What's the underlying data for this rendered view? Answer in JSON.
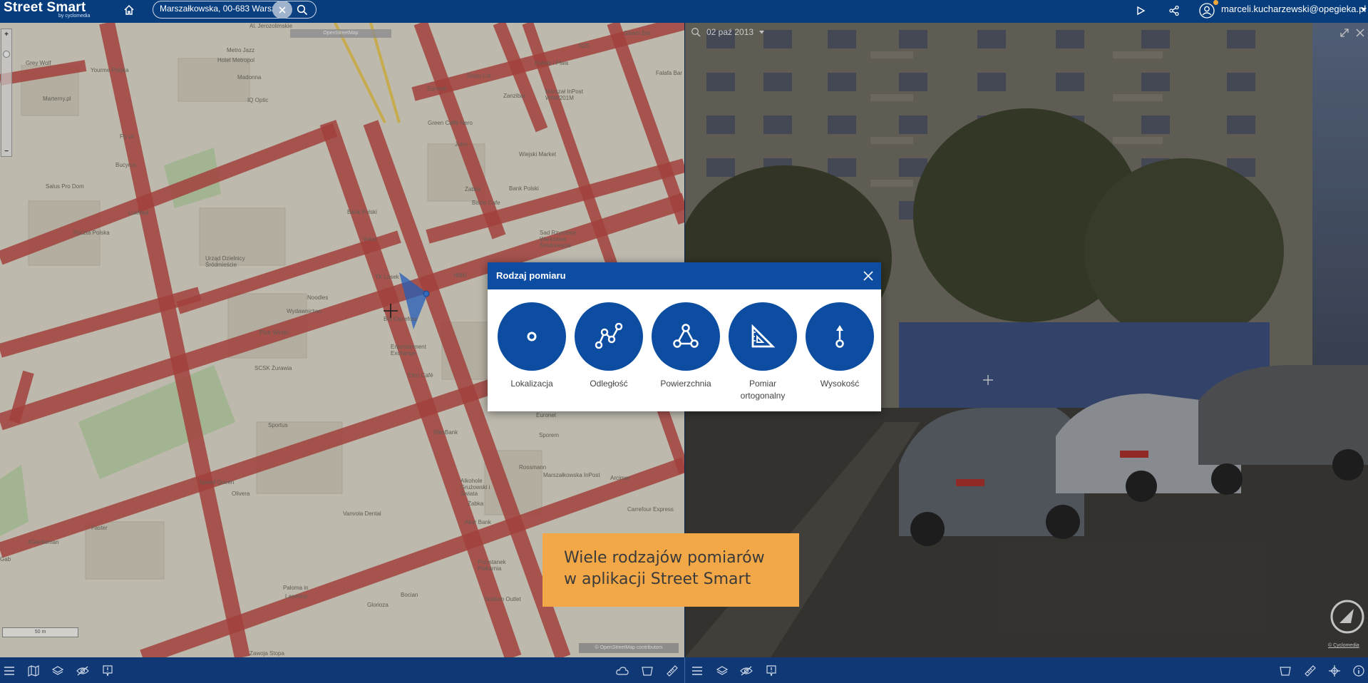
{
  "app": {
    "title": "Street Smart",
    "subtitle": "by cyclomedia"
  },
  "search": {
    "value": "Marszałkowska, 00-683 Warsz"
  },
  "user": {
    "email": "marceli.kucharzewski@opegieka.pl"
  },
  "icons": {
    "home": "home-icon",
    "search": "search-icon",
    "clear": "close-icon",
    "play": "play-icon",
    "share": "share-icon",
    "user": "user-icon",
    "menu": "menu-icon",
    "map": "map-icon",
    "layers": "layers-icon",
    "eye_off": "eye-off-icon",
    "marker": "marker-icon",
    "cloud": "cloud-icon",
    "bucket": "bucket-icon",
    "ruler": "ruler-icon",
    "crosshair": "crosshair-icon",
    "info": "info-icon"
  },
  "map": {
    "osm_tag": "OpenStreetMap",
    "attribution": "© OpenStreetMap contributors",
    "scale": "50 m",
    "labels": [
      "Al. Jerozolimskie",
      "Metro Jazz",
      "Hotel Metropol",
      "Grey Wolf",
      "Yourme Polska",
      "Madonna",
      "Marterny.pl",
      "IQ Optic",
      "Euronet",
      "Disco Lot",
      "Zanzibar",
      "Green Caffè Nero",
      "Jutro",
      "Żabka",
      "Bank Polski",
      "Volvo",
      "TK Lasek",
      "Noodles",
      "Wydawnictwo",
      "Bio Carrefour",
      "Piotr Wirski",
      "SCSK Żurawia",
      "Entertainment Exchange",
      "Etno Café",
      "Poczta Polska",
      "LuxMed",
      "Urząd Dzielnicy Śródmieście",
      "Salus Pro Dom",
      "Bucyrus",
      "Fly pl",
      "Sportus",
      "WesBank",
      "Speed Queen",
      "Olivera",
      "Rossmann",
      "Alkohole Grużowski i Świata",
      "Żabka",
      "Akor Bank",
      "Carrefour Express",
      "Vanvola Dental",
      "Faster",
      "4Gentleman",
      "Paloma in",
      "Laserma",
      "Glorioza",
      "Bocian",
      "Przystanek Piekarnia",
      "Sodium Outlet",
      "Zawoja Stopa",
      "Gab",
      "Arcimar",
      "Kwiaty i Plwa",
      "Steam Bar",
      "N25",
      "Falafa Bar",
      "Marszał InPost WAW201M",
      "Sad Rzymowy Warszawa Śródmieście",
      "Bank Polski",
      "Bistro Cafe",
      "Euronet",
      "Sporem",
      "Marszałkowska InPost",
      "Wiejski Market",
      "NMN"
    ]
  },
  "panorama": {
    "date": "02 paź 2013",
    "attribution": "© Cyclomedia"
  },
  "modal": {
    "title": "Rodzaj pomiaru",
    "options": [
      {
        "label": "Lokalizacja",
        "icon": "point-icon"
      },
      {
        "label": "Odległość",
        "icon": "polyline-icon"
      },
      {
        "label": "Powierzchnia",
        "icon": "polygon-icon"
      },
      {
        "label": "Pomiar",
        "label2": "ortogonalny",
        "icon": "set-square-icon"
      },
      {
        "label": "Wysokość",
        "icon": "height-icon"
      }
    ]
  },
  "caption": {
    "line1": "Wiele rodzajów pomiarów",
    "line2": "w aplikacji Street Smart"
  },
  "colors": {
    "topbar": "#073d7d",
    "accent_blue": "#0c4da2",
    "caption_orange": "#f3a848",
    "road_red": "#b84a45"
  }
}
